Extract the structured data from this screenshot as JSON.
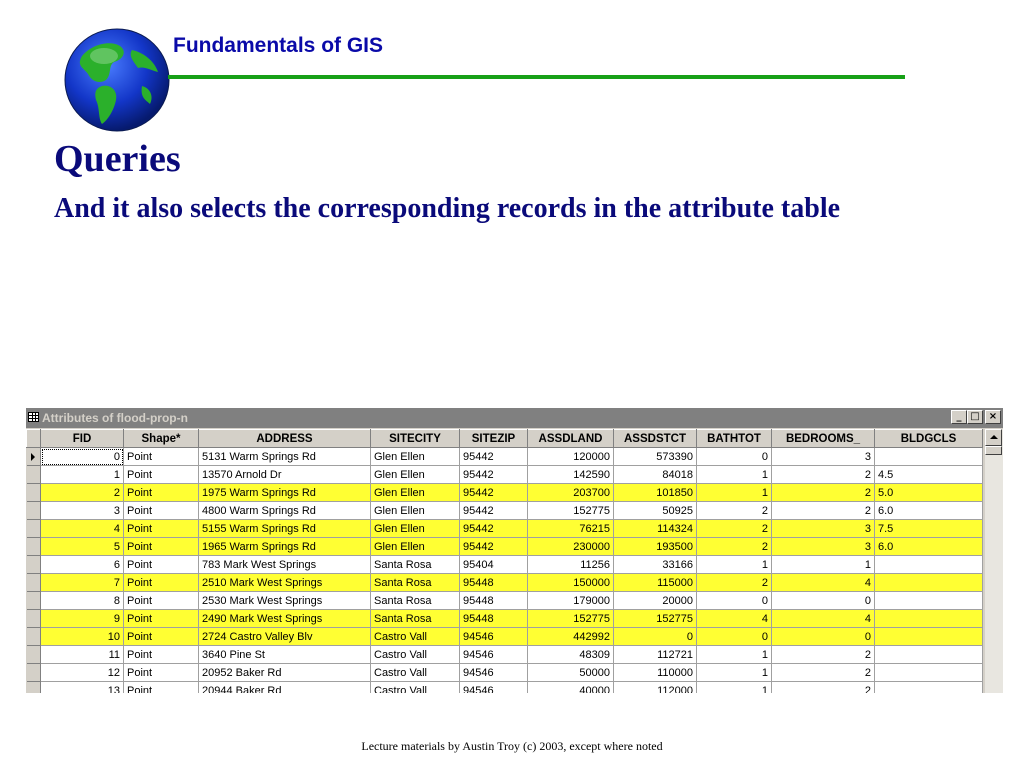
{
  "header": {
    "title": "Fundamentals of GIS"
  },
  "slide": {
    "title": "Queries",
    "subtitle": "And it also selects the corresponding records in the attribute table"
  },
  "footer": {
    "text": "Lecture materials by Austin Troy (c) 2003, except where noted"
  },
  "colors": {
    "selected_row": "#ffff33",
    "header_rule": "#17a017",
    "title_text": "#0a0a7a"
  },
  "window": {
    "title": "Attributes of flood-prop-n",
    "minimize": "_",
    "maximize": "□",
    "close": "×"
  },
  "table": {
    "columns": [
      "FID",
      "Shape*",
      "ADDRESS",
      "SITECITY",
      "SITEZIP",
      "ASSDLAND",
      "ASSDSTCT",
      "BATHTOT",
      "BEDROOMS_",
      "BLDGCLS"
    ],
    "rows": [
      {
        "selected": false,
        "cells": [
          "0",
          "Point",
          "5131 Warm Springs Rd",
          "Glen Ellen",
          "95442",
          "120000",
          "573390",
          "0",
          "3",
          ""
        ]
      },
      {
        "selected": false,
        "cells": [
          "1",
          "Point",
          "13570 Arnold Dr",
          "Glen Ellen",
          "95442",
          "142590",
          "84018",
          "1",
          "2",
          "4.5"
        ]
      },
      {
        "selected": true,
        "cells": [
          "2",
          "Point",
          "1975 Warm Springs Rd",
          "Glen Ellen",
          "95442",
          "203700",
          "101850",
          "1",
          "2",
          "5.0"
        ]
      },
      {
        "selected": false,
        "cells": [
          "3",
          "Point",
          "4800 Warm Springs Rd",
          "Glen Ellen",
          "95442",
          "152775",
          "50925",
          "2",
          "2",
          "6.0"
        ]
      },
      {
        "selected": true,
        "cells": [
          "4",
          "Point",
          "5155 Warm Springs Rd",
          "Glen Ellen",
          "95442",
          "76215",
          "114324",
          "2",
          "3",
          "7.5"
        ]
      },
      {
        "selected": true,
        "cells": [
          "5",
          "Point",
          "1965 Warm Springs Rd",
          "Glen Ellen",
          "95442",
          "230000",
          "193500",
          "2",
          "3",
          "6.0"
        ]
      },
      {
        "selected": false,
        "cells": [
          "6",
          "Point",
          "783 Mark West Springs",
          "Santa Rosa",
          "95404",
          "11256",
          "33166",
          "1",
          "1",
          ""
        ]
      },
      {
        "selected": true,
        "cells": [
          "7",
          "Point",
          "2510 Mark West Springs",
          "Santa Rosa",
          "95448",
          "150000",
          "115000",
          "2",
          "4",
          ""
        ]
      },
      {
        "selected": false,
        "cells": [
          "8",
          "Point",
          "2530 Mark West Springs",
          "Santa Rosa",
          "95448",
          "179000",
          "20000",
          "0",
          "0",
          ""
        ]
      },
      {
        "selected": true,
        "cells": [
          "9",
          "Point",
          "2490 Mark West Springs",
          "Santa Rosa",
          "95448",
          "152775",
          "152775",
          "4",
          "4",
          ""
        ]
      },
      {
        "selected": true,
        "cells": [
          "10",
          "Point",
          "2724 Castro Valley Blv",
          "Castro Vall",
          "94546",
          "442992",
          "0",
          "0",
          "0",
          ""
        ]
      },
      {
        "selected": false,
        "cells": [
          "11",
          "Point",
          "3640 Pine St",
          "Castro Vall",
          "94546",
          "48309",
          "112721",
          "1",
          "2",
          ""
        ]
      },
      {
        "selected": false,
        "cells": [
          "12",
          "Point",
          "20952 Baker Rd",
          "Castro Vall",
          "94546",
          "50000",
          "110000",
          "1",
          "2",
          ""
        ]
      },
      {
        "selected": false,
        "cells": [
          "13",
          "Point",
          "20944 Baker Rd",
          "Castro Vall",
          "94546",
          "40000",
          "112000",
          "1",
          "2",
          ""
        ]
      }
    ]
  }
}
